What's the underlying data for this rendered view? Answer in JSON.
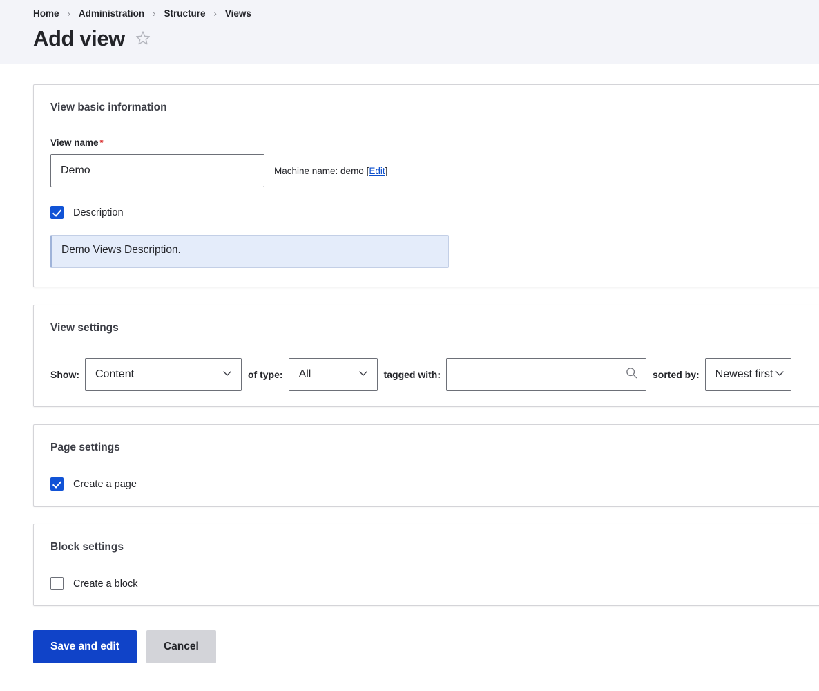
{
  "header": {
    "breadcrumb": [
      {
        "label": "Home"
      },
      {
        "label": "Administration"
      },
      {
        "label": "Structure"
      },
      {
        "label": "Views"
      }
    ],
    "separator": "›",
    "title": "Add view",
    "bookmark_icon": "star-outline-icon"
  },
  "basic_information": {
    "section_title": "View basic information",
    "view_name_label": "View name",
    "required_mark": "*",
    "view_name_value": "Demo",
    "view_name_placeholder": "",
    "machine_name_prefix": "Machine name: demo [",
    "machine_name_edit_link": "Edit",
    "machine_name_suffix": "]",
    "description_checkbox_label": "Description",
    "description_checked": true,
    "description_value": "Demo Views Description.",
    "description_placeholder": ""
  },
  "view_settings": {
    "section_title": "View settings",
    "show_label": "Show:",
    "show_value": "Content",
    "of_type_label": "of type:",
    "of_type_value": "All",
    "tagged_with_label": "tagged with:",
    "tagged_with_value": "",
    "tagged_with_placeholder": "",
    "search_icon": "search-icon",
    "sorted_by_label": "sorted by:",
    "sorted_by_value": "Newest first",
    "chevron_icon": "chevron-down-icon"
  },
  "page_settings": {
    "section_title": "Page settings",
    "create_page_label": "Create a page",
    "create_page_checked": true
  },
  "block_settings": {
    "section_title": "Block settings",
    "create_block_label": "Create a block",
    "create_block_checked": false
  },
  "actions": {
    "save_label": "Save and edit",
    "cancel_label": "Cancel"
  },
  "colors": {
    "accent_blue": "#1043c8",
    "checkbox_blue": "#1153d6",
    "link_blue": "#0b4ecc",
    "required_red": "#d72222",
    "header_bg": "#f3f4f9",
    "description_bg": "#e4ecfa",
    "cancel_bg": "#d3d4d9"
  }
}
